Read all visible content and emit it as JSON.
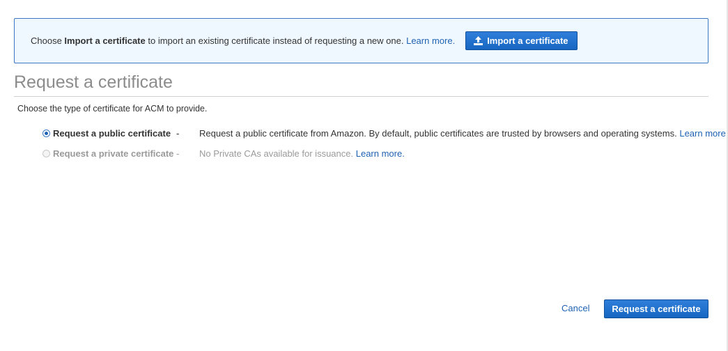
{
  "banner": {
    "prefix": "Choose ",
    "bold": "Import a certificate",
    "suffix": " to import an existing certificate instead of requesting a new one.",
    "learn_more": "Learn more.",
    "import_button": "Import a certificate",
    "import_icon": "upload-icon"
  },
  "page": {
    "title": "Request a certificate",
    "subtitle": "Choose the type of certificate for ACM to provide."
  },
  "options": [
    {
      "label": "Request a public certificate",
      "separator": "-",
      "description": "Request a public certificate from Amazon. By default, public certificates are trusted by browsers and operating systems.",
      "learn_more": "Learn more.",
      "selected": true,
      "disabled": false
    },
    {
      "label": "Request a private certificate",
      "separator": "-",
      "description": "No Private CAs available for issuance.",
      "learn_more": "Learn more.",
      "selected": false,
      "disabled": true
    }
  ],
  "footer": {
    "cancel": "Cancel",
    "submit": "Request a certificate"
  },
  "colors": {
    "primary": "#1766c2",
    "link": "#1f62b4",
    "banner_bg": "#f0f8ff",
    "banner_border": "#3b78c4"
  }
}
